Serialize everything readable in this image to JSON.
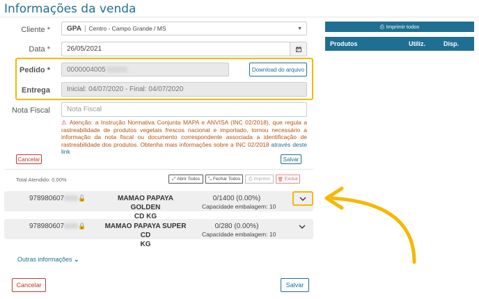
{
  "page_title": "Informações da venda",
  "form": {
    "cliente_label": "Cliente",
    "cliente_name": "GPA",
    "cliente_detail": "Centro - Campo Grande / MS",
    "data_label": "Data",
    "data_value": "26/05/2021",
    "pedido_label": "Pedido",
    "pedido_value": "0000004005",
    "download_label": "Download do arquivo",
    "entrega_label": "Entrega",
    "entrega_value": "Inicial: 04/07/2020 - Final: 04/07/2020",
    "nota_label": "Nota Fiscal",
    "nota_placeholder": "Nota Fiscal",
    "required_mark": "*",
    "warning_text": "Atenção: a Instrução Normativa Conjunta MAPA e ANVISA (INC 02/2018), que regula a rastreabilidade de produtos vegetais frescos nacional e importado, tornou necessário a informação da nota fiscal ou documento correspondente associada a identificação de rastreabilidade dos produtos. Obtenha mais informações sobre a INC 02/2018",
    "warning_link": "através deste link",
    "cancel_small": "Cancelar",
    "save_small": "Salvar"
  },
  "toolbar": {
    "total_label": "Total Atendido: 0.00%",
    "abrir": "Abrir Todos",
    "fechar": "Fechar Todos",
    "imprimir": "Imprimir",
    "excluir": "Excluir"
  },
  "products": [
    {
      "code": "978980607",
      "name_line1": "MAMAO PAPAYA GOLDEN",
      "name_line2": "CD KG",
      "qty": "0/1400 (0.00%)",
      "capacity": "Capacidade embalagem: 10"
    },
    {
      "code": "978980607",
      "name_line1": "MAMAO PAPAYA SUPER CD",
      "name_line2": "KG",
      "qty": "0/280 (0.00%)",
      "capacity": "Capacidade embalagem: 10"
    }
  ],
  "outras_label": "Outras informações",
  "footer": {
    "cancel": "Cancelar",
    "save": "Salvar"
  },
  "right_panel": {
    "print_all": "Imprimir todos",
    "col_produtos": "Produtos",
    "col_utiliz": "Utiliz.",
    "col_disp": "Disp."
  },
  "colors": {
    "accent": "#1f6f93",
    "highlight": "#f5b800",
    "danger": "#c0392b",
    "warning": "#b6520e"
  }
}
